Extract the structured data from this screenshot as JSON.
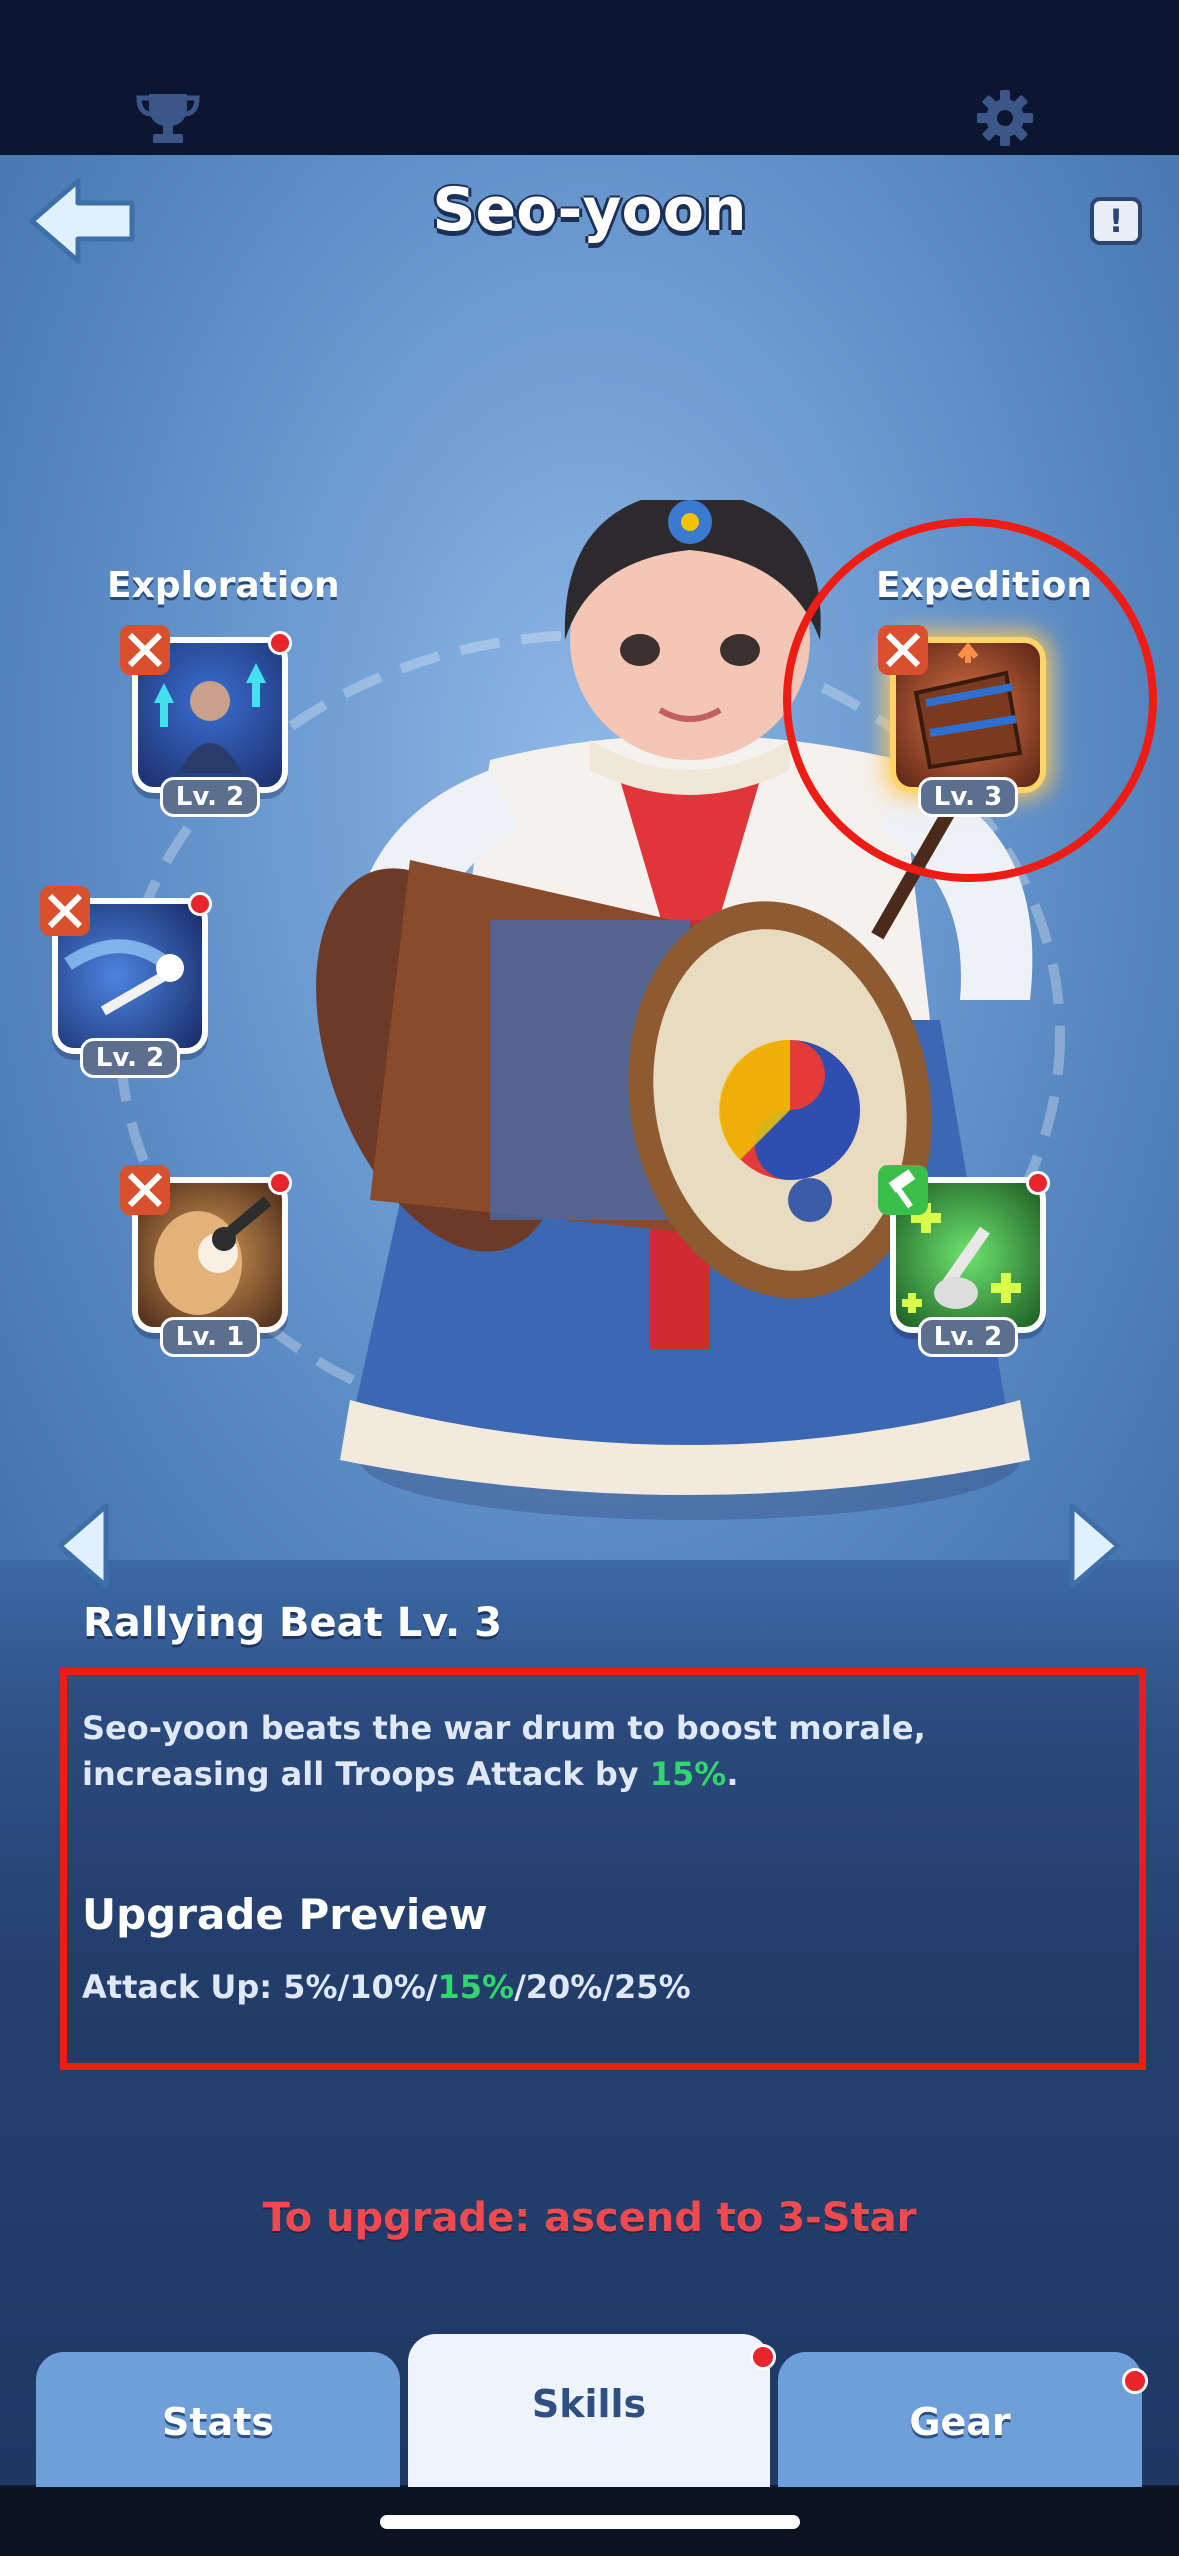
{
  "top_bar": {
    "left_icon": "trophy-icon",
    "right_icon": "gear-icon"
  },
  "header": {
    "title": "Seo-yoon",
    "back_icon": "back-arrow-icon",
    "info_icon": "!"
  },
  "skill_groups": {
    "left_label": "Exploration",
    "right_label": "Expedition"
  },
  "skills": [
    {
      "name": "exploration-skill-1",
      "level": "Lv. 2",
      "tag": "crossed-swords-icon",
      "notification": true
    },
    {
      "name": "exploration-skill-2",
      "level": "Lv. 2",
      "tag": "crossed-swords-icon",
      "notification": true
    },
    {
      "name": "exploration-skill-3",
      "level": "Lv. 1",
      "tag": "crossed-swords-icon",
      "notification": true
    },
    {
      "name": "expedition-skill-1",
      "level": "Lv. 3",
      "tag": "crossed-swords-icon",
      "notification": false,
      "selected": true
    },
    {
      "name": "expedition-skill-2",
      "level": "Lv. 2",
      "tag": "hammer-icon",
      "notification": true
    }
  ],
  "selected_skill": {
    "title": "Rallying Beat Lv. 3",
    "description_before": "Seo-yoon beats the war drum to boost morale, increasing all Troops Attack by ",
    "description_highlight": "15%",
    "description_after": ".",
    "upgrade_title": "Upgrade Preview",
    "upgrade_prefix": "Attack Up: 5%/10%/",
    "upgrade_highlight": "15%",
    "upgrade_suffix": "/20%/25%",
    "upgrade_requirement": "To upgrade: ascend to 3-Star"
  },
  "tabs": [
    {
      "label": "Stats",
      "active": false,
      "notification": false
    },
    {
      "label": "Skills",
      "active": true,
      "notification": true
    },
    {
      "label": "Gear",
      "active": false,
      "notification": true
    }
  ],
  "colors": {
    "highlight": "#31d66f",
    "warning": "#f04a4e",
    "annotation": "#ee1c15"
  }
}
